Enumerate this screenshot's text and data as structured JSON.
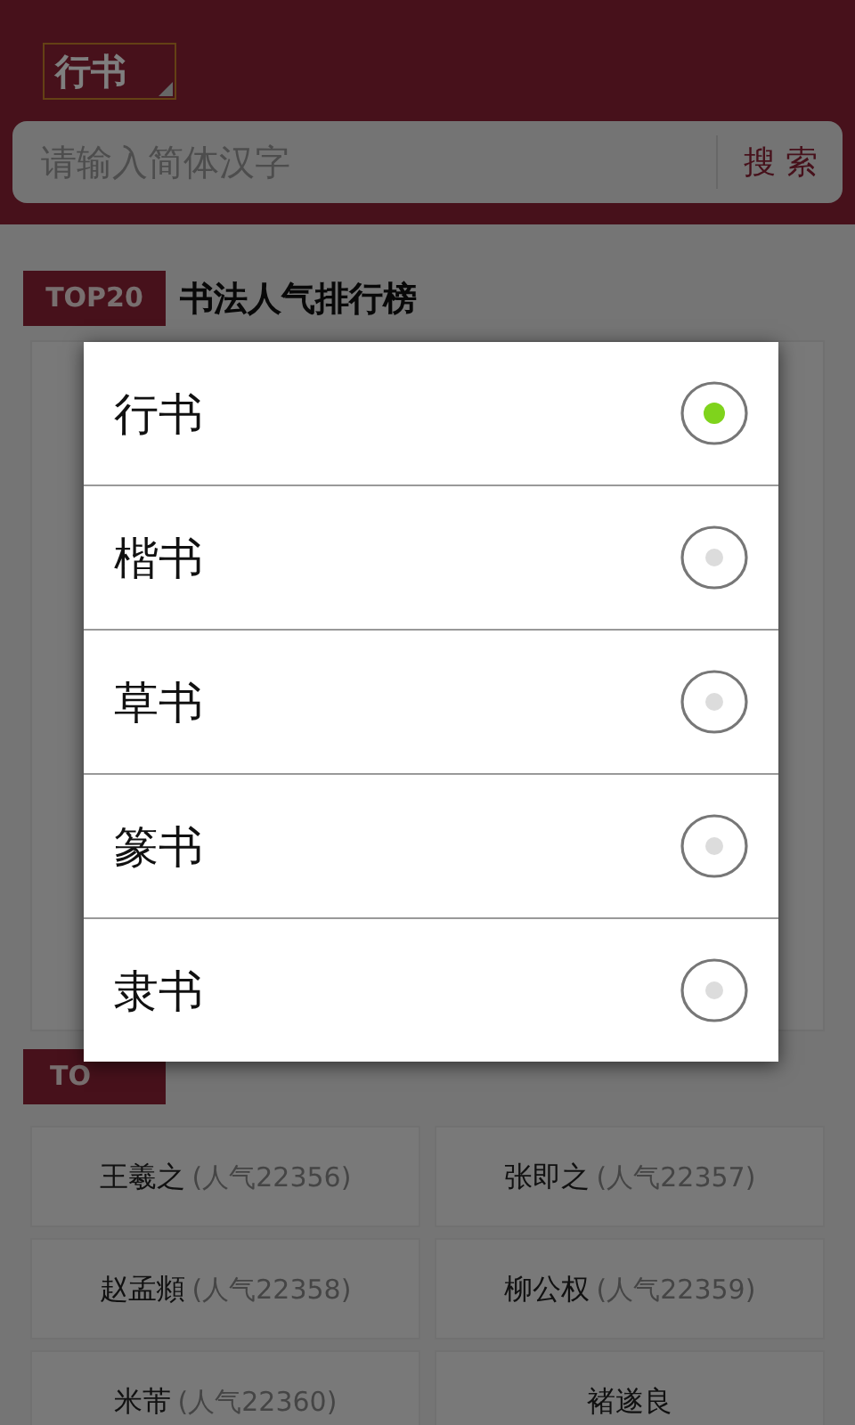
{
  "header": {
    "style_button": "行书",
    "search": {
      "placeholder": "请输入简体汉字",
      "button": "搜 索"
    }
  },
  "ranking": {
    "badge": "TOP20",
    "title": "书法人气排行榜"
  },
  "second_section": {
    "badge": "TO"
  },
  "people": [
    {
      "name": "王羲之",
      "count": "(人气22356)"
    },
    {
      "name": "张即之",
      "count": "(人气22357)"
    },
    {
      "name": "赵孟頫",
      "count": "(人气22358)"
    },
    {
      "name": "柳公权",
      "count": "(人气22359)"
    },
    {
      "name": "米芾",
      "count": "(人气22360)"
    },
    {
      "name": "褚遂良"
    }
  ],
  "dialog": {
    "options": [
      {
        "label": "行书",
        "selected": true
      },
      {
        "label": "楷书",
        "selected": false
      },
      {
        "label": "草书",
        "selected": false
      },
      {
        "label": "篆书",
        "selected": false
      },
      {
        "label": "隶书",
        "selected": false
      }
    ]
  }
}
